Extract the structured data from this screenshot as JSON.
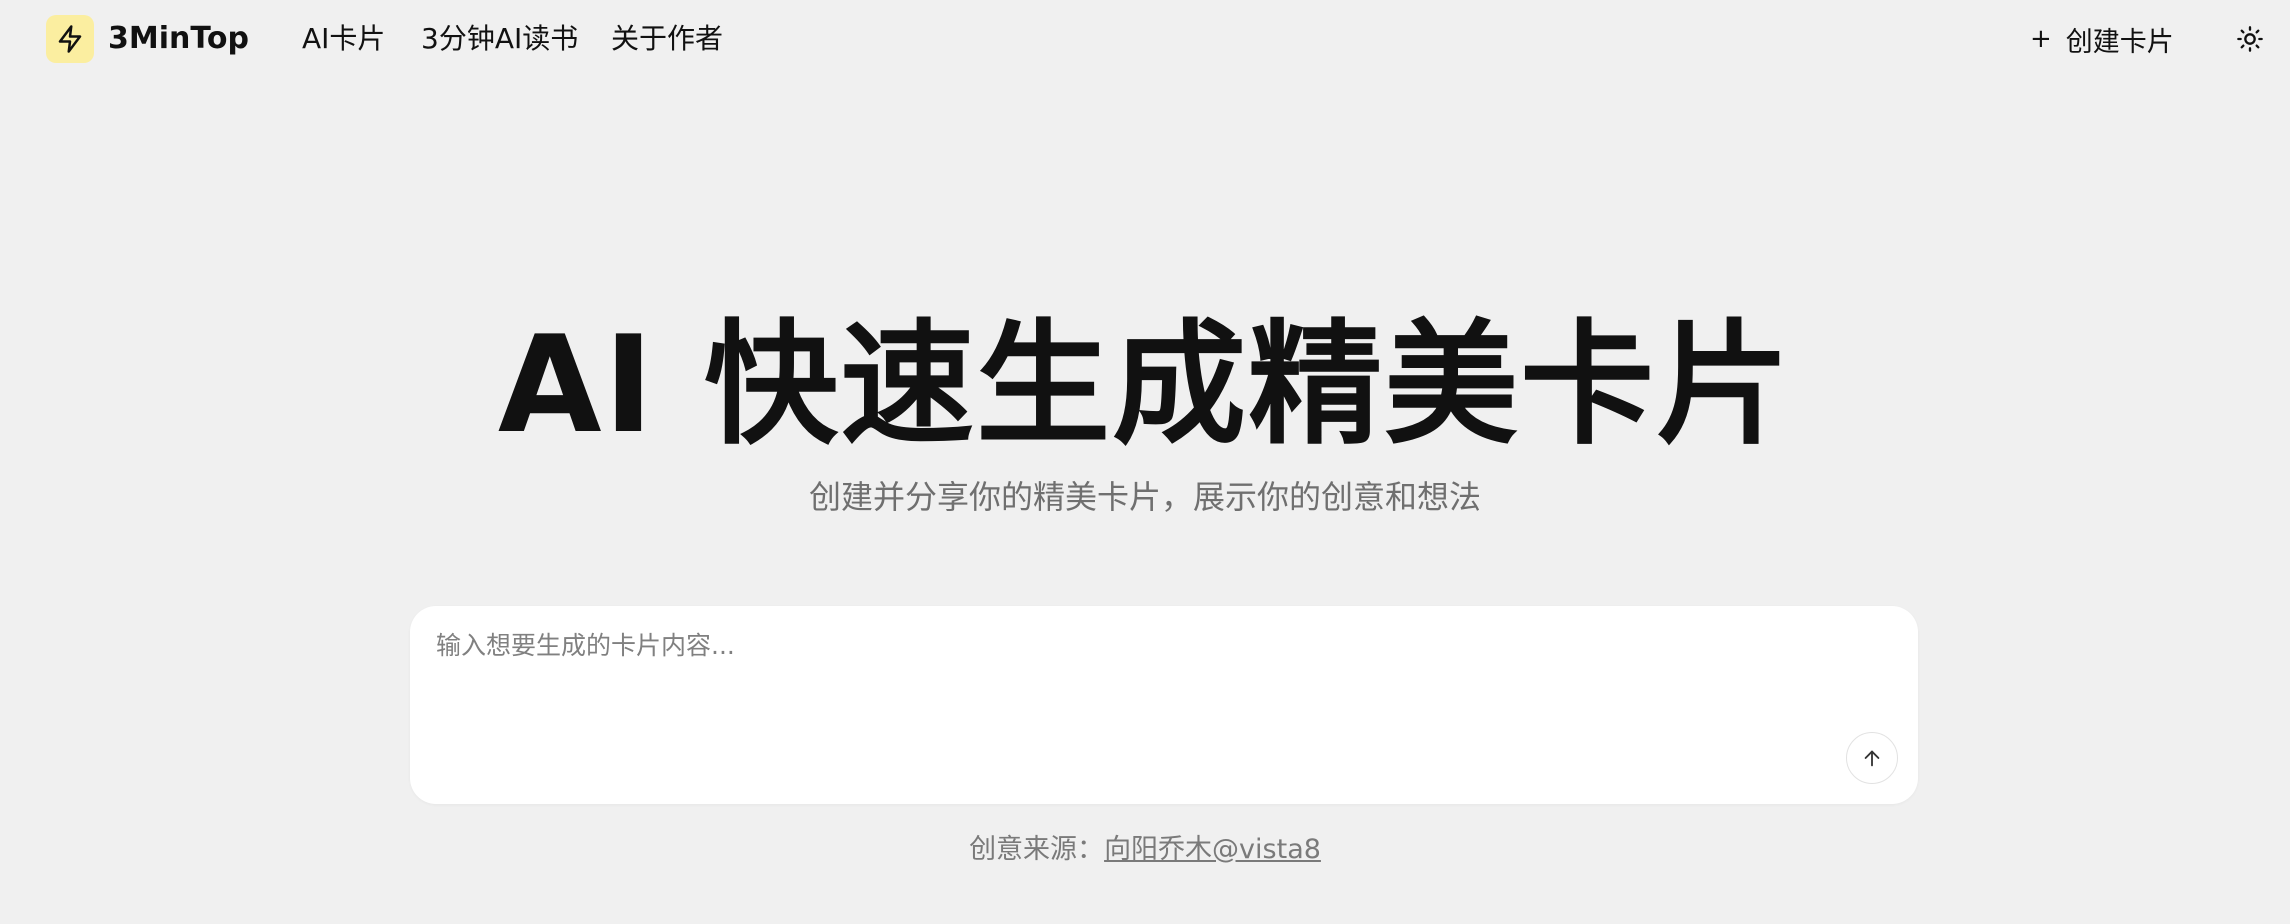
{
  "header": {
    "brand": "3MinTop",
    "logo_icon": "lightning-bolt-icon",
    "logo_color": "#fbeea0",
    "nav": [
      {
        "label": "AI卡片"
      },
      {
        "label": "3分钟AI读书"
      },
      {
        "label": "关于作者"
      }
    ],
    "create_button": {
      "icon": "+",
      "label": "创建卡片"
    },
    "theme_toggle_icon": "sun-icon"
  },
  "hero": {
    "title": "AI 快速生成精美卡片",
    "subtitle": "创建并分享你的精美卡片，展示你的创意和想法"
  },
  "composer": {
    "placeholder": "输入想要生成的卡片内容...",
    "value": "",
    "send_icon": "arrow-up-icon"
  },
  "footer": {
    "credit_prefix": "创意来源：",
    "credit_link": "向阳乔木@vista8"
  }
}
